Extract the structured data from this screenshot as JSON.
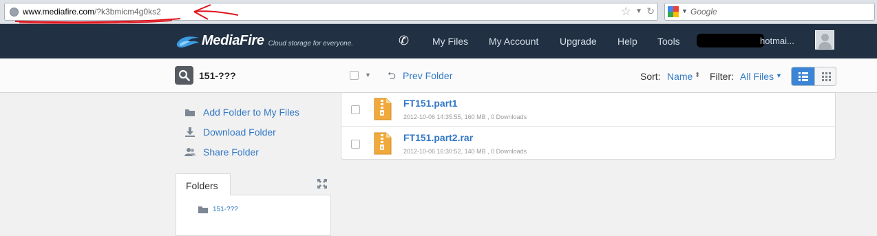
{
  "browser": {
    "url_host": "www.mediafire.com",
    "url_path": "/?k3bmicm4g0ks2",
    "search_placeholder": "Google"
  },
  "header": {
    "logo": "MediaFire",
    "tagline": "Cloud storage for everyone.",
    "nav": [
      "My Files",
      "My Account",
      "Upgrade",
      "Help",
      "Tools"
    ],
    "user_email": "hotmai..."
  },
  "toolbar": {
    "folder_name": "151-???",
    "prev_folder": "Prev Folder",
    "sort_label": "Sort:",
    "sort_value": "Name",
    "filter_label": "Filter:",
    "filter_value": "All Files"
  },
  "sidebar": {
    "actions": [
      "Add Folder to My Files",
      "Download Folder",
      "Share Folder"
    ],
    "folders_tab": "Folders",
    "tree_item": "151-???"
  },
  "files": [
    {
      "name": "FT151.part1",
      "meta": "2012-10-06 14:35:55, 160 MB , 0 Downloads"
    },
    {
      "name": "FT151.part2.rar",
      "meta": "2012-10-06 16:30:52, 140 MB , 0 Downloads"
    }
  ],
  "colors": {
    "header_bg": "#213043",
    "link_blue": "#3178c6",
    "active_view": "#3c84d6",
    "annotation_red": "#e0141b"
  },
  "icons": [
    "globe-icon",
    "star-icon",
    "google-icon",
    "flame-logo-icon",
    "phone-icon",
    "avatar-icon",
    "search-icon",
    "prev-folder-icon",
    "list-view-icon",
    "grid-view-icon",
    "folder-add-icon",
    "download-icon",
    "share-icon",
    "expand-icon",
    "folder-icon",
    "zip-file-icon"
  ]
}
